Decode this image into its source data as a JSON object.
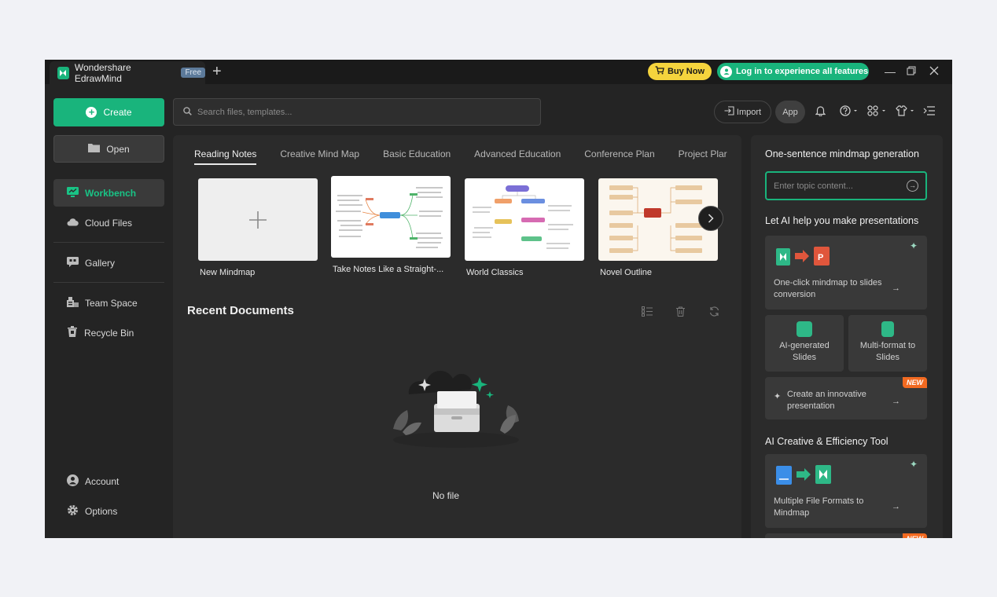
{
  "titlebar": {
    "app_name": "Wondershare EdrawMind",
    "plan_badge": "Free",
    "buy_label": "Buy Now",
    "login_label": "Log in to experience all features"
  },
  "sidebar": {
    "create_label": "Create",
    "open_label": "Open",
    "items": [
      {
        "label": "Workbench",
        "icon": "workbench-icon",
        "active": true
      },
      {
        "label": "Cloud Files",
        "icon": "cloud-icon"
      },
      {
        "label": "Gallery",
        "icon": "gallery-icon"
      },
      {
        "label": "Team Space",
        "icon": "team-icon"
      },
      {
        "label": "Recycle Bin",
        "icon": "trash-icon"
      }
    ],
    "bottom": [
      {
        "label": "Account",
        "icon": "account-icon"
      },
      {
        "label": "Options",
        "icon": "gear-icon"
      }
    ]
  },
  "toolbar": {
    "search_placeholder": "Search files, templates...",
    "import_label": "Import",
    "app_label": "App"
  },
  "templates": {
    "tabs": [
      "Reading Notes",
      "Creative Mind Map",
      "Basic Education",
      "Advanced Education",
      "Conference Plan",
      "Project Plar"
    ],
    "active_tab": "Reading Notes",
    "cards": [
      {
        "label": "New Mindmap"
      },
      {
        "label": "Take Notes Like a Straight-..."
      },
      {
        "label": "World Classics"
      },
      {
        "label": "Novel Outline"
      }
    ]
  },
  "recent": {
    "title": "Recent Documents",
    "empty_text": "No file"
  },
  "ai_panel": {
    "generation_title": "One-sentence mindmap generation",
    "topic_placeholder": "Enter topic content...",
    "presentations_title": "Let AI help you make presentations",
    "slides_conversion": "One-click mindmap to slides conversion",
    "ai_generated_slides": "AI-generated Slides",
    "multi_format_slides": "Multi-format to Slides",
    "innovative_presentation": "Create an innovative presentation",
    "new_badge": "NEW",
    "creative_title": "AI Creative & Efficiency Tool",
    "multi_formats_to_mindmap": "Multiple File Formats to Mindmap"
  },
  "colors": {
    "brand": "#19b47c",
    "buy": "#f5d43d",
    "new_badge": "#f26a21"
  }
}
